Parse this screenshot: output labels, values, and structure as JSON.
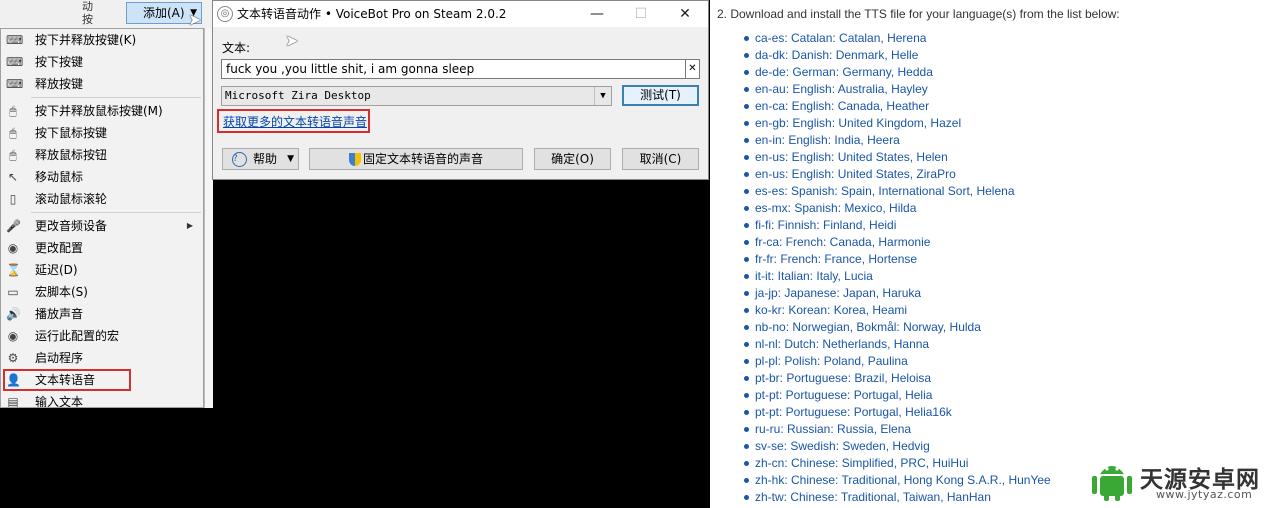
{
  "background_window": {
    "side_label": "动\n按",
    "add_button": "添加(A)"
  },
  "menu": {
    "items": [
      {
        "label": "按下并释放按键(K)",
        "icon": "keyboard-press-release-icon"
      },
      {
        "label": "按下按键",
        "icon": "keyboard-press-icon"
      },
      {
        "label": "释放按键",
        "icon": "keyboard-release-icon"
      },
      {
        "label": "按下并释放鼠标按键(M)",
        "icon": "mouse-click-icon"
      },
      {
        "label": "按下鼠标按键",
        "icon": "mouse-press-icon"
      },
      {
        "label": "释放鼠标按钮",
        "icon": "mouse-release-icon"
      },
      {
        "label": "移动鼠标",
        "icon": "pointer-icon"
      },
      {
        "label": "滚动鼠标滚轮",
        "icon": "scroll-wheel-icon"
      },
      {
        "label": "更改音频设备",
        "icon": "audio-device-icon"
      },
      {
        "label": "更改配置",
        "icon": "eye-icon"
      },
      {
        "label": "延迟(D)",
        "icon": "hourglass-icon"
      },
      {
        "label": "宏脚本(S)",
        "icon": "script-icon"
      },
      {
        "label": "播放声音",
        "icon": "speaker-icon"
      },
      {
        "label": "运行此配置的宏",
        "icon": "eye-icon"
      },
      {
        "label": "启动程序",
        "icon": "gear-icon"
      },
      {
        "label": "文本转语音",
        "icon": "person-icon"
      },
      {
        "label": "输入文本",
        "icon": "document-icon"
      }
    ]
  },
  "dialog": {
    "title": "文本转语音动作 • VoiceBot Pro on Steam 2.0.2",
    "text_label": "文本:",
    "text_value": "fuck you ,you little shit, i am gonna sleep",
    "voice_selected": "Microsoft Zira Desktop",
    "test_button": "测试(T)",
    "more_voices_link": "获取更多的文本转语音声音",
    "help_button": "帮助",
    "fix_voice_button": "固定文本转语音的声音",
    "ok_button": "确定(O)",
    "cancel_button": "取消(C)"
  },
  "doc": {
    "heading": "2. Download and install the TTS file for your language(s) from the list below:",
    "languages": [
      "ca-es: Catalan: Catalan, Herena",
      "da-dk: Danish: Denmark, Helle",
      "de-de: German: Germany, Hedda",
      "en-au: English: Australia, Hayley",
      "en-ca: English: Canada, Heather",
      "en-gb: English: United Kingdom, Hazel",
      "en-in: English: India, Heera",
      "en-us: English: United States, Helen",
      "en-us: English: United States, ZiraPro",
      "es-es: Spanish: Spain, International Sort, Helena",
      "es-mx: Spanish: Mexico, Hilda",
      "fi-fi: Finnish: Finland, Heidi",
      "fr-ca: French: Canada, Harmonie",
      "fr-fr: French: France, Hortense",
      "it-it: Italian: Italy, Lucia",
      "ja-jp: Japanese: Japan, Haruka",
      "ko-kr: Korean: Korea, Heami",
      "nb-no: Norwegian, Bokmål: Norway, Hulda",
      "nl-nl: Dutch: Netherlands, Hanna",
      "pl-pl: Polish: Poland, Paulina",
      "pt-br: Portuguese: Brazil, Heloisa",
      "pt-pt: Portuguese: Portugal, Helia",
      "pt-pt: Portuguese: Portugal, Helia16k",
      "ru-ru: Russian: Russia, Elena",
      "sv-se: Swedish: Sweden, Hedvig",
      "zh-cn: Chinese: Simplified, PRC, HuiHui",
      "zh-hk: Chinese: Traditional, Hong Kong S.A.R., HunYee",
      "zh-tw: Chinese: Traditional, Taiwan, HanHan"
    ]
  },
  "watermark": {
    "name": "天源安卓网",
    "url": "www.jytyaz.com"
  },
  "colors": {
    "highlight_red": "#d32f2f",
    "link_blue": "#1a56a6",
    "watermark_green": "#3aa835"
  }
}
